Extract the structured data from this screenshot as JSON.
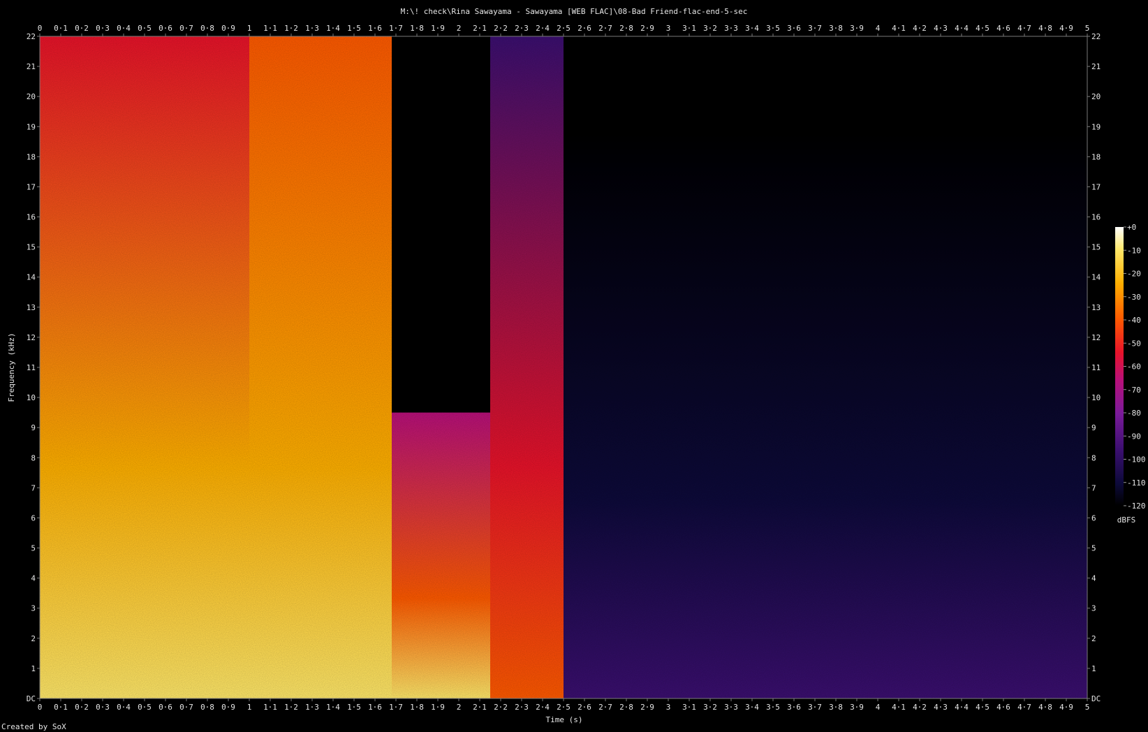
{
  "window": {
    "title": "M:\\! check\\Rina Sawayama - Sawayama [WEB FLAC]\\08-Bad Friend-flac-end-5-sec",
    "credit": "Created by SoX"
  },
  "colors": {
    "background": "#000000",
    "axis": "#7a7a7a",
    "text": "#e6e6e6",
    "colormap": [
      "#000000",
      "#0d0a3a",
      "#3b0f70",
      "#7a1a9a",
      "#b8107a",
      "#e8132a",
      "#ff5a00",
      "#ffb000",
      "#ffe86a",
      "#ffffff"
    ]
  },
  "chart_data": {
    "type": "heatmap",
    "title": "M:\\! check\\Rina Sawayama - Sawayama [WEB FLAC]\\08-Bad Friend-flac-end-5-sec",
    "xlabel": "Time (s)",
    "ylabel": "Frequency (kHz)",
    "xlim": [
      0,
      5
    ],
    "ylim": [
      0,
      22
    ],
    "x_ticks": [
      "0",
      "0·1",
      "0·2",
      "0·3",
      "0·4",
      "0·5",
      "0·6",
      "0·7",
      "0·8",
      "0·9",
      "1",
      "1·1",
      "1·2",
      "1·3",
      "1·4",
      "1·5",
      "1·6",
      "1·7",
      "1·8",
      "1·9",
      "2",
      "2·1",
      "2·2",
      "2·3",
      "2·4",
      "2·5",
      "2·6",
      "2·7",
      "2·8",
      "2·9",
      "3",
      "3·1",
      "3·2",
      "3·3",
      "3·4",
      "3·5",
      "3·6",
      "3·7",
      "3·8",
      "3·9",
      "4",
      "4·1",
      "4·2",
      "4·3",
      "4·4",
      "4·5",
      "4·6",
      "4·7",
      "4·8",
      "4·9",
      "5"
    ],
    "y_ticks": [
      "DC",
      "1",
      "2",
      "3",
      "4",
      "5",
      "6",
      "7",
      "8",
      "9",
      "10",
      "11",
      "12",
      "13",
      "14",
      "15",
      "16",
      "17",
      "18",
      "19",
      "20",
      "21",
      "22"
    ],
    "colorbar": {
      "label": "dBFS",
      "ticks": [
        "+0",
        "-10",
        "-20",
        "-30",
        "-40",
        "-50",
        "-60",
        "-70",
        "-80",
        "-90",
        "-100",
        "-110",
        "-120"
      ],
      "range": [
        -120,
        0
      ]
    },
    "segments": [
      {
        "t_start": 0.0,
        "t_end": 1.0,
        "level_db": -35,
        "low_freq_db": -15,
        "cutoff_khz": 22
      },
      {
        "t_start": 1.0,
        "t_end": 1.68,
        "level_db": -30,
        "low_freq_db": -15,
        "cutoff_khz": 22
      },
      {
        "t_start": 1.68,
        "t_end": 2.15,
        "level_db": -60,
        "low_freq_db": -20,
        "cutoff_khz": 9.5
      },
      {
        "t_start": 2.15,
        "t_end": 2.5,
        "level_db": -75,
        "low_freq_db": -45,
        "cutoff_khz": 22
      },
      {
        "t_start": 2.5,
        "t_end": 5.0,
        "level_db": -108,
        "low_freq_db": -100,
        "cutoff_khz": 19
      }
    ]
  }
}
